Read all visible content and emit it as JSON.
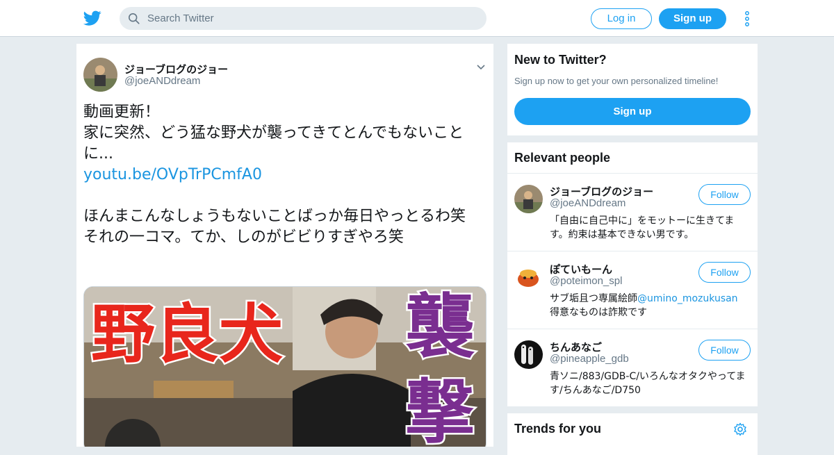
{
  "header": {
    "logo_icon": "twitter-bird-icon",
    "search_placeholder": "Search Twitter",
    "login_label": "Log in",
    "signup_label": "Sign up",
    "more_icon": "vertical-ellipsis-icon",
    "brand_color": "#1da1f2"
  },
  "tweet": {
    "author_name": "ジョーブログのジョー",
    "author_handle": "@joeANDdream",
    "text_line1": "動画更新！",
    "text_line2": "家に突然、どう猛な野犬が襲ってきてとんでもないことに...",
    "link": "youtu.be/OVpTrPCmfA0",
    "text_line3": "ほんまこんなしょうもないことばっか毎日やっとるわ笑",
    "text_line4": "それの一コマ。てか、しのがビビりすぎやろ笑",
    "media": {
      "caption_left": "野良犬",
      "caption_right_1": "襲",
      "caption_right_2": "撃"
    }
  },
  "sidebar": {
    "new_to_twitter": {
      "title": "New to Twitter?",
      "subtitle": "Sign up now to get your own personalized timeline!",
      "button": "Sign up"
    },
    "relevant_people": {
      "title": "Relevant people",
      "follow_label": "Follow",
      "people": [
        {
          "name": "ジョーブログのジョー",
          "handle": "@joeANDdream",
          "bio": "「自由に自己中に」をモットーに生きてます。約束は基本できない男です。"
        },
        {
          "name": "ぽていもーん",
          "handle": "@poteimon_spl",
          "bio_prefix": "サブ垢且つ専属絵師",
          "bio_mention": "@umino_mozukusan",
          "bio_suffix": "得意なものは詐欺です"
        },
        {
          "name": "ちんあなご",
          "handle": "@pineapple_gdb",
          "bio": "青ソニ/883/GDB-C/いろんなオタクやってます/ちんあなご/D750"
        }
      ]
    },
    "trends": {
      "title": "Trends for you",
      "settings_icon": "gear-icon"
    }
  }
}
